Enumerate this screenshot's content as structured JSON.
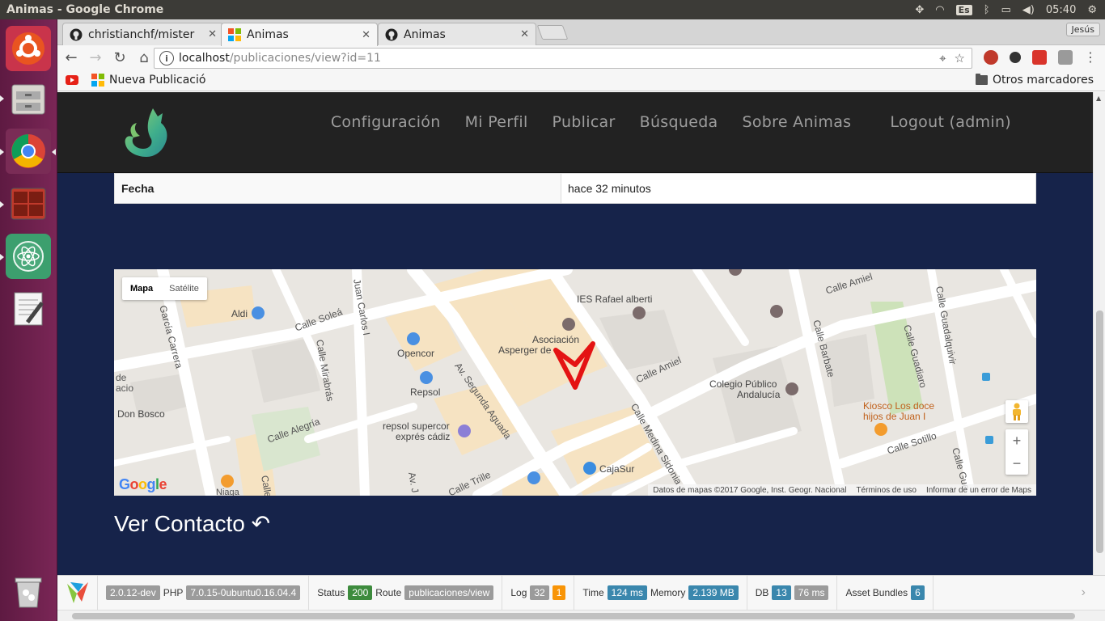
{
  "os": {
    "window_title": "Animas - Google Chrome",
    "keyboard_layout": "Es",
    "clock": "05:40",
    "user": "Jesús"
  },
  "browser": {
    "tabs": [
      {
        "label": "christianchf/mister",
        "icon": "github-icon",
        "close": "✕"
      },
      {
        "label": "Animas",
        "icon": "yii-icon",
        "close": "✕"
      },
      {
        "label": "Animas",
        "icon": "github-icon",
        "close": "✕"
      }
    ],
    "url_host": "localhost",
    "url_path": "/publicaciones/view?id=11",
    "bookmarks": [
      {
        "label": "",
        "icon": "youtube-icon"
      },
      {
        "label": "Nueva Publicació",
        "icon": "yii-icon"
      }
    ],
    "other_bookmarks": "Otros marcadores"
  },
  "site": {
    "menu": [
      "Configuración",
      "Mi Perfil",
      "Publicar",
      "Búsqueda",
      "Sobre Animas",
      "Logout (admin)"
    ],
    "detail": {
      "label": "Fecha",
      "value": "hace 32 minutos"
    },
    "ver_contacto": "Ver Contacto ↶"
  },
  "map": {
    "type_buttons": [
      "Mapa",
      "Satélite"
    ],
    "selected_type": "Mapa",
    "labels": {
      "ies": "IES Rafael alberti",
      "asociacion1": "Asociación",
      "asociacion2": "Asperger de",
      "aldi": "Aldi",
      "opencor": "Opencor",
      "repsol": "Repsol",
      "repsol2a": "repsol supercor",
      "repsol2b": "exprés cádiz",
      "colegio1": "Colegio Público",
      "colegio2": "Andalucía",
      "kiosco1": "Kiosco Los doce",
      "kiosco2": "hijos de Juan I",
      "cajasur": "CajaSur",
      "donbosco": "Don Bosco",
      "de": "de",
      "acio": "acio",
      "niaga": "Niaga",
      "calle_solea": "Calle Soleá",
      "calle_mirabras": "Calle Mirabrás",
      "calle_alegria": "Calle Alegría",
      "garcia_carrera": "García Carrera",
      "juan_carlos": "Juan Carlos I",
      "av_segunda_aguada": "Av. Segunda Aguada",
      "calle_amiel": "Calle Amiel",
      "calle_amiel2": "Calle Amiel",
      "calle_barbate": "Calle Barbate",
      "calle_medina": "Calle Medina Sidonia",
      "calle_guadiaro": "Calle Guadiaro",
      "calle_guadalquivir": "Calle Guadalquivir",
      "calle_sotillo": "Calle Sotillo",
      "calle_trille": "Calle Trille",
      "calle_gue": "Calle Gue",
      "av_j": "Av. J",
      "calle_c": "Calle"
    },
    "footer": [
      "Datos de mapas ©2017 Google, Inst. Geogr. Nacional",
      "Términos de uso",
      "Informar de un error de Maps"
    ],
    "google": "Google",
    "zoom_in": "+",
    "zoom_out": "−"
  },
  "debug": {
    "version": "2.0.12-dev",
    "php_label": "PHP",
    "php_version": "7.0.15-0ubuntu0.16.04.4",
    "status_label": "Status",
    "status": "200",
    "route_label": "Route",
    "route": "publicaciones/view",
    "log_label": "Log",
    "log_count": "32",
    "log_warn": "1",
    "time_label": "Time",
    "time": "124 ms",
    "memory_label": "Memory",
    "memory": "2.139 MB",
    "db_label": "DB",
    "db_count": "13",
    "db_time": "76 ms",
    "assets_label": "Asset Bundles",
    "assets": "6"
  }
}
